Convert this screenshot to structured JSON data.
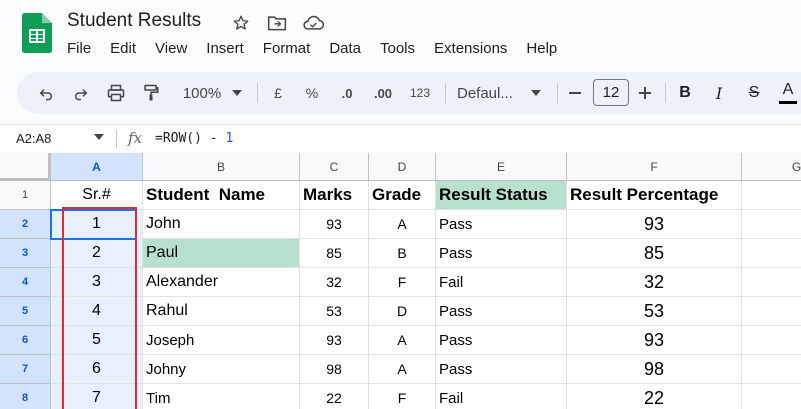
{
  "app": {
    "title": "Student Results",
    "menu": [
      "File",
      "Edit",
      "View",
      "Insert",
      "Format",
      "Data",
      "Tools",
      "Extensions",
      "Help"
    ]
  },
  "toolbar": {
    "zoom": "100%",
    "currency": "£",
    "percent": "%",
    "decrease_decimal": ".0",
    "increase_decimal": ".00",
    "number_format": "123",
    "font": "Defaul...",
    "font_size": "12",
    "bold": "B",
    "italic": "I",
    "strike": "S",
    "text_color": "A"
  },
  "formula_bar": {
    "name_box": "A2:A8",
    "formula_prefix": "=ROW() - ",
    "formula_num": "1"
  },
  "columns": [
    "A",
    "B",
    "C",
    "D",
    "E",
    "F",
    "G"
  ],
  "row_numbers": [
    "1",
    "2",
    "3",
    "4",
    "5",
    "6",
    "7",
    "8"
  ],
  "headers": {
    "a": "Sr.#",
    "b": "Student  Name",
    "c": "Marks",
    "d": "Grade",
    "e": "Result Status",
    "f": "Result Percentage"
  },
  "rows": [
    {
      "a": "1",
      "b": "John",
      "c": "93",
      "d": "A",
      "e": "Pass",
      "f": "93"
    },
    {
      "a": "2",
      "b": "Paul",
      "c": "85",
      "d": "B",
      "e": "Pass",
      "f": "85"
    },
    {
      "a": "3",
      "b": "Alexander",
      "c": "32",
      "d": "F",
      "e": "Fail",
      "f": "32"
    },
    {
      "a": "4",
      "b": "Rahul",
      "c": "53",
      "d": "D",
      "e": "Pass",
      "f": "53"
    },
    {
      "a": "5",
      "b": "Joseph",
      "c": "93",
      "d": "A",
      "e": "Pass",
      "f": "93"
    },
    {
      "a": "6",
      "b": "Johny",
      "c": "98",
      "d": "A",
      "e": "Pass",
      "f": "98"
    },
    {
      "a": "7",
      "b": "Tim",
      "c": "22",
      "d": "F",
      "e": "Fail",
      "f": "22"
    }
  ],
  "colors": {
    "highlight_green": "#b7e1cd",
    "selection_blue": "#1a73e8",
    "annotation_red": "#e32b2b"
  }
}
